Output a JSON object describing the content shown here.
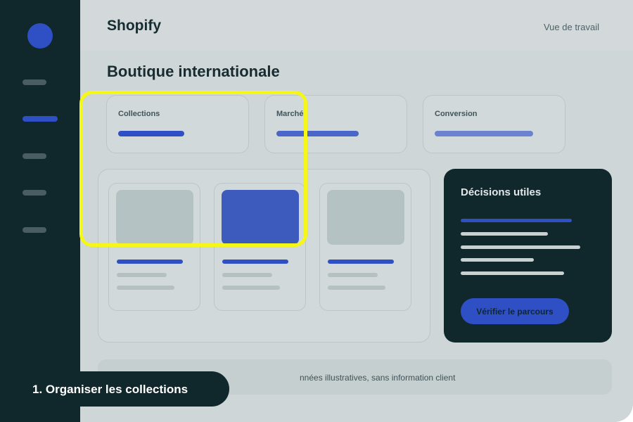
{
  "header": {
    "brand": "Shopify",
    "work_view_link": "Vue de travail"
  },
  "page": {
    "title": "Boutique internationale"
  },
  "stats": [
    {
      "label": "Collections",
      "bar_color": "#2f4fc4"
    },
    {
      "label": "Marché",
      "bar_color": "#4a66c8"
    },
    {
      "label": "Conversion",
      "bar_color": "#6a82cf"
    }
  ],
  "decision_panel": {
    "title": "Décisions utiles",
    "button_label": "Vérifier le parcours"
  },
  "notice": {
    "text": "nnées illustratives, sans information client"
  },
  "step": {
    "label": "1. Organiser les collections"
  },
  "colors": {
    "accent": "#2f4fc4",
    "sidebar": "#10272c",
    "highlight": "#f5f719"
  }
}
